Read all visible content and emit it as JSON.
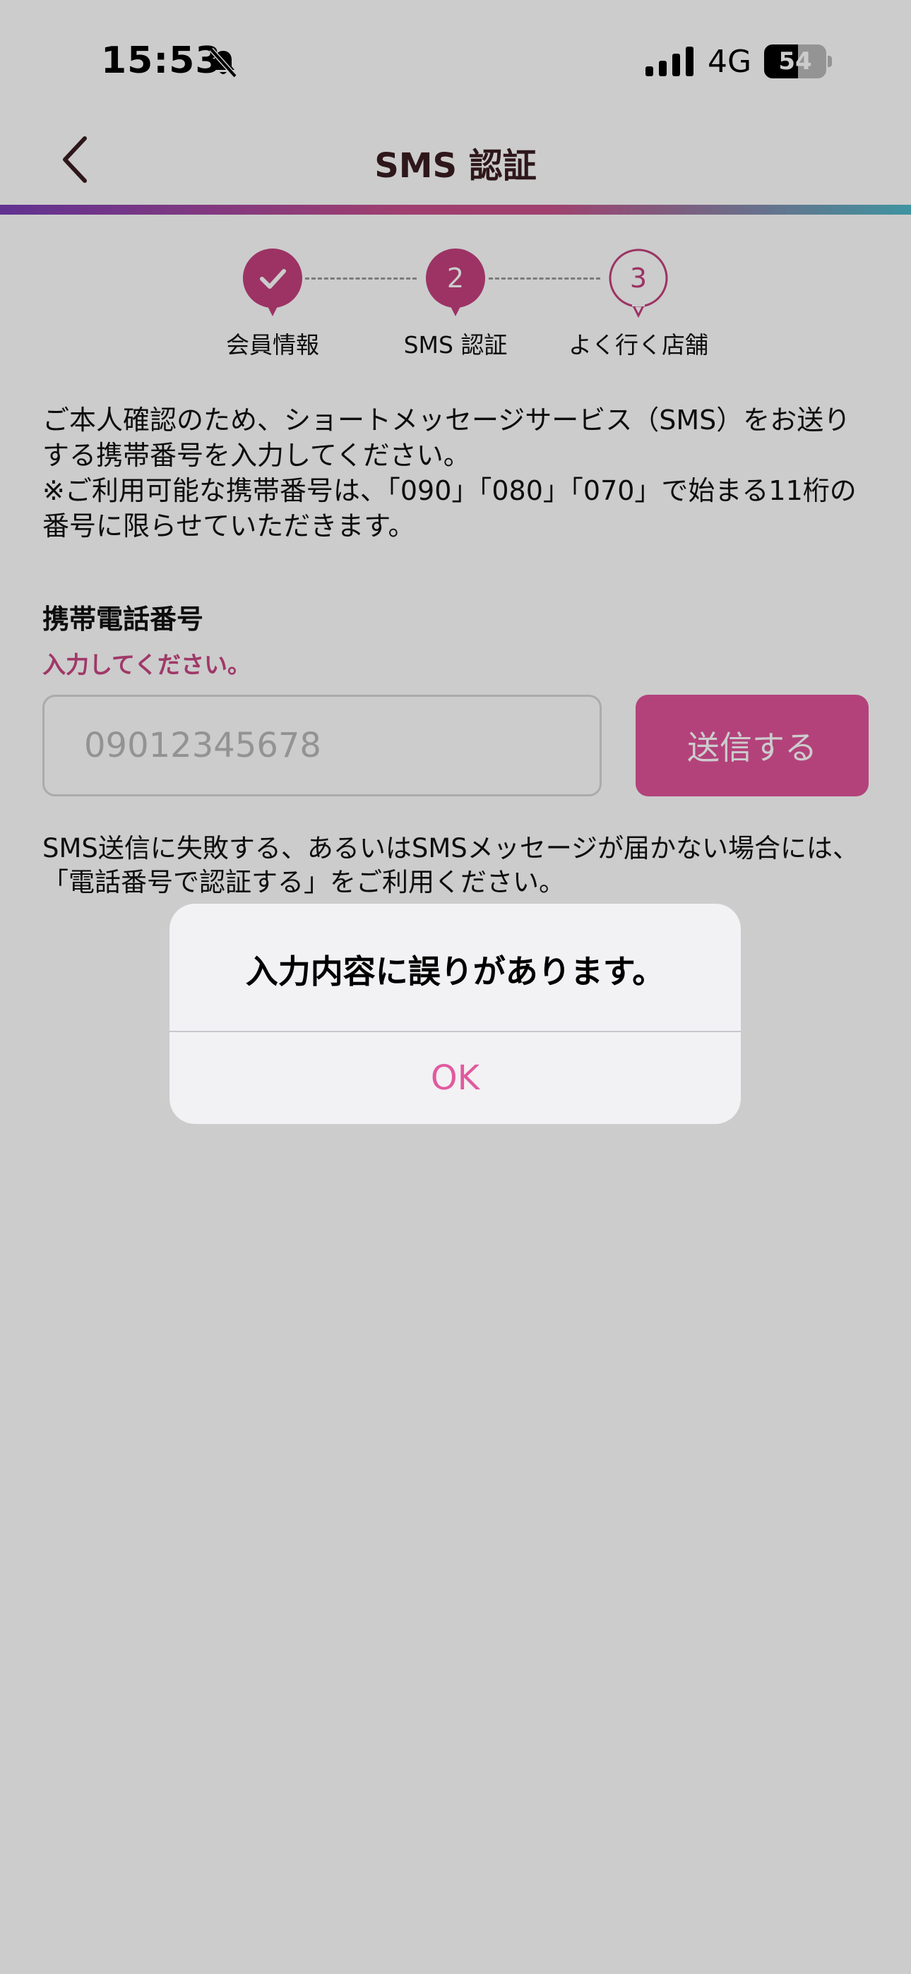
{
  "status_bar": {
    "time": "15:53",
    "network": "4G",
    "battery_percent": 54,
    "battery_label": "54"
  },
  "header": {
    "title": "SMS 認証"
  },
  "stepper": {
    "steps": [
      {
        "label": "会員情報",
        "state": "done",
        "number": ""
      },
      {
        "label": "SMS 認証",
        "state": "current",
        "number": "2"
      },
      {
        "label": "よく行く店舗",
        "state": "upcoming",
        "number": "3"
      }
    ]
  },
  "intro": {
    "line1": "ご本人確認のため、ショートメッセージサービス（SMS）をお送りする携帯番号を入力してください。",
    "line2": "※ご利用可能な携帯番号は、「090」「080」「070」で始まる11桁の番号に限らせていただきます。"
  },
  "form": {
    "label": "携帯電話番号",
    "error": "入力してください。",
    "value": "",
    "placeholder": "09012345678",
    "send_label": "送信する"
  },
  "help": {
    "text": "SMS送信に失敗する、あるいはSMSメッセージが届かない場合には、「電話番号で認証する」をご利用ください。"
  },
  "dialog": {
    "message": "入力内容に誤りがあります。",
    "ok_label": "OK"
  },
  "colors": {
    "accent": "#e0539a",
    "title": "#3a1d22",
    "error": "#c94783"
  },
  "icons": {
    "back": "chevron-left-icon",
    "bell": "bell-slash-icon",
    "check": "check-icon"
  }
}
